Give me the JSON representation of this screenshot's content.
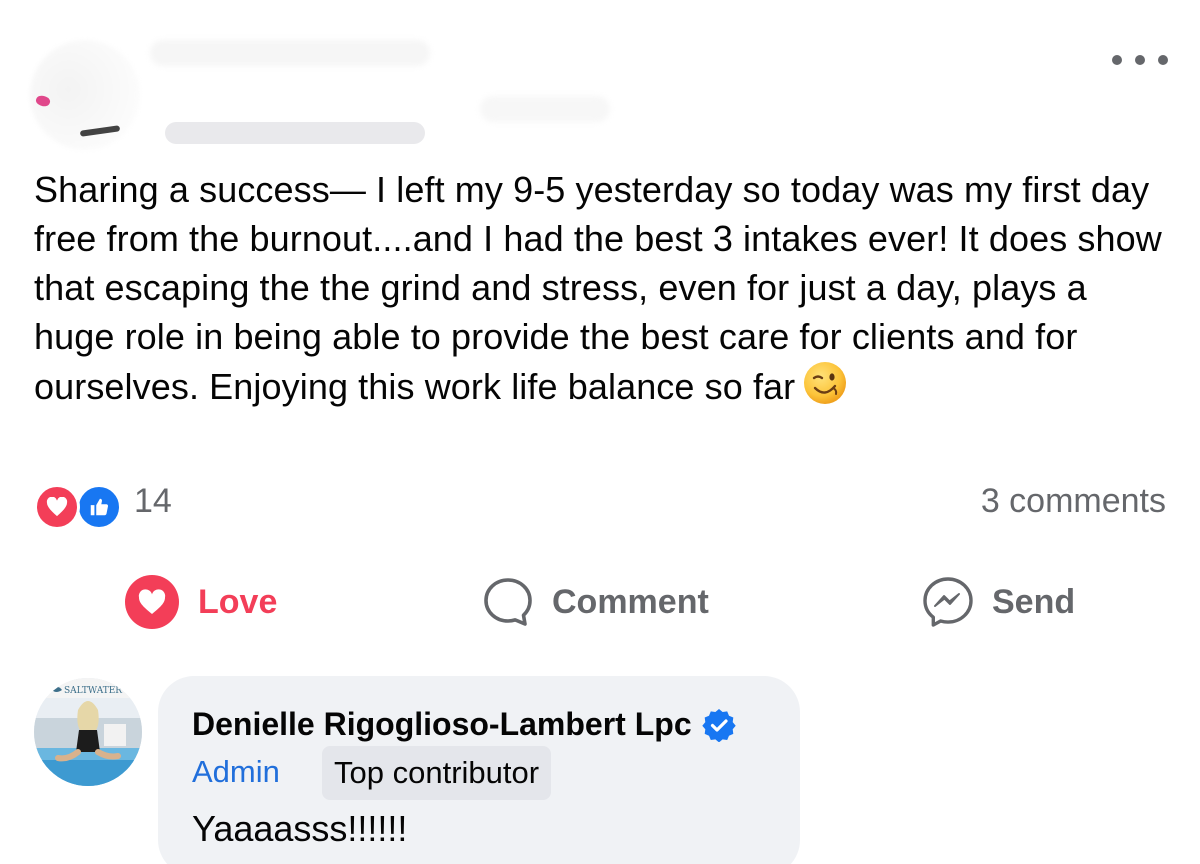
{
  "post": {
    "text": "Sharing a success— I left my 9-5 yesterday so today was my first day free from the burnout....and I had the best 3 intakes ever! It does show that escaping the the grind and stress, even for just a day, plays a huge role in being able to provide the best care for clients and for ourselves. Enjoying this work life balance so far",
    "emoji": "winking-face",
    "reaction_count": "14",
    "comments_count": "3 comments"
  },
  "actions": {
    "love_label": "Love",
    "comment_label": "Comment",
    "send_label": "Send"
  },
  "comment": {
    "author": "Denielle Rigoglioso-Lambert Lpc",
    "avatar_text": "SALTWATER",
    "badge_admin": "Admin",
    "badge_top": "Top contributor",
    "text": "Yaaaasss!!!!!!"
  },
  "colors": {
    "love_red": "#f33e58",
    "like_blue": "#1877f2",
    "admin_blue": "#216fdb",
    "secondary_text": "#65676b",
    "bubble_bg": "#f0f2f5"
  }
}
